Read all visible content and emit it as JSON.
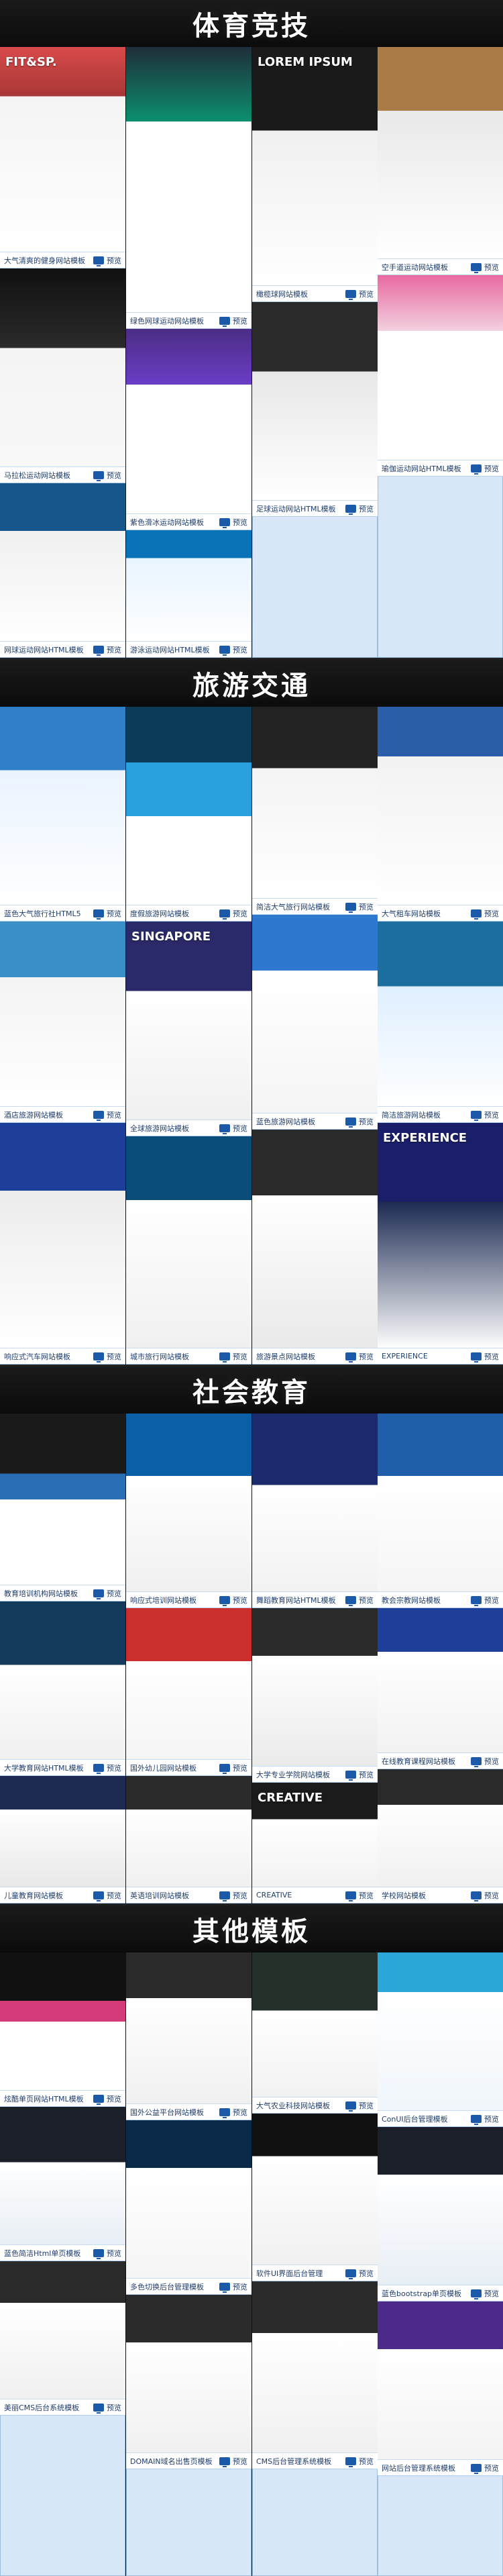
{
  "sections": [
    {
      "title": "体育竞技",
      "items": [
        {
          "caption": "大气清爽的健身网站模板",
          "preview": "预览",
          "thumb": {
            "title": "FIT&SP.",
            "colors": [
              "#d94a4a",
              "#f4f4f4",
              "#ffffff"
            ]
          }
        },
        {
          "caption": "绿色网球运动网站模板",
          "preview": "预览",
          "thumb": {
            "title": "",
            "colors": [
              "#0c8f6e",
              "#1f2e3a",
              "#ffffff"
            ]
          }
        },
        {
          "caption": "橄榄球网站模板",
          "preview": "预览",
          "thumb": {
            "title": "LOREM IPSUM",
            "colors": [
              "#1a1a1a",
              "#f0f0f0",
              "#ffffff"
            ]
          }
        },
        {
          "caption": "空手道运动网站模板",
          "preview": "预览",
          "thumb": {
            "title": "",
            "colors": [
              "#a97c47",
              "#e9e9e9",
              "#ffffff"
            ]
          }
        },
        {
          "caption": "马拉松运动网站模板",
          "preview": "预览",
          "thumb": {
            "title": "",
            "colors": [
              "#111",
              "#f4f4f4",
              "#f8f8f8"
            ]
          }
        },
        {
          "caption": "紫色滑冰运动网站模板",
          "preview": "预览",
          "thumb": {
            "title": "",
            "colors": [
              "#4b2d84",
              "#ffffff",
              "#6a3dc6"
            ]
          }
        },
        {
          "caption": "足球运动网站HTML模板",
          "preview": "预览",
          "thumb": {
            "title": "",
            "colors": [
              "#2a2a2a",
              "#e8e8e8",
              "#ffffff"
            ]
          }
        },
        {
          "caption": "瑜伽运动网站HTML模板",
          "preview": "预览",
          "thumb": {
            "title": "",
            "colors": [
              "#e96aa0",
              "#ffffff",
              "#f2d0df"
            ]
          }
        },
        {
          "caption": "网球运动网站HTML模板",
          "preview": "预览",
          "thumb": {
            "title": "",
            "colors": [
              "#17568b",
              "#f0f0f0",
              "#ffffff"
            ]
          }
        },
        {
          "caption": "游泳运动网站HTML模板",
          "preview": "预览",
          "thumb": {
            "title": "",
            "colors": [
              "#0a73b7",
              "#e8f4ff",
              "#ffffff"
            ]
          }
        }
      ]
    },
    {
      "title": "旅游交通",
      "items": [
        {
          "caption": "蓝色大气旅行社HTML5",
          "preview": "预览",
          "thumb": {
            "title": "",
            "colors": [
              "#2e7ec8",
              "#ffffff",
              "#eaf3ff"
            ]
          }
        },
        {
          "caption": "度假旅游网站模板",
          "preview": "预览",
          "thumb": {
            "title": "",
            "colors": [
              "#0c3b5a",
              "#2aa0de",
              "#ffffff"
            ]
          }
        },
        {
          "caption": "简洁大气旅行网站模板",
          "preview": "预览",
          "thumb": {
            "title": "",
            "colors": [
              "#222",
              "#f4f4f4",
              "#1b74c5"
            ]
          }
        },
        {
          "caption": "大气租车网站模板",
          "preview": "预览",
          "thumb": {
            "title": "",
            "colors": [
              "#2a5ea8",
              "#f2f2f2",
              "#ffffff"
            ]
          }
        },
        {
          "caption": "酒店旅游网站模板",
          "preview": "预览",
          "thumb": {
            "title": "",
            "colors": [
              "#3b8fc9",
              "#ffffff",
              "#f4f4f4"
            ]
          }
        },
        {
          "caption": "全球旅游网站模板",
          "preview": "预览",
          "thumb": {
            "title": "SINGAPORE",
            "colors": [
              "#2a2a6a",
              "#ffffff",
              "#f0f0f0"
            ]
          }
        },
        {
          "caption": "蓝色旅游网站模板",
          "preview": "预览",
          "thumb": {
            "title": "",
            "colors": [
              "#2f78d0",
              "#ffffff",
              "#f5f5f5"
            ]
          }
        },
        {
          "caption": "简洁旅游网站模板",
          "preview": "预览",
          "thumb": {
            "title": "",
            "colors": [
              "#1b6e9e",
              "#dfefff",
              "#ffffff"
            ]
          }
        },
        {
          "caption": "响应式汽车网站模板",
          "preview": "预览",
          "thumb": {
            "title": "",
            "colors": [
              "#1d3f9a",
              "#ffffff",
              "#ececec"
            ]
          }
        },
        {
          "caption": "城市旅行网站模板",
          "preview": "预览",
          "thumb": {
            "title": "",
            "colors": [
              "#0a4c7a",
              "#fff",
              "#f0f0f0"
            ]
          }
        },
        {
          "caption": "旅游景点网站模板",
          "preview": "预览",
          "thumb": {
            "title": "",
            "colors": [
              "#2a2a2a",
              "#ffffff",
              "#e9e9e9"
            ]
          }
        },
        {
          "caption": "EXPERIENCE",
          "preview": "预览",
          "thumb": {
            "title": "EXPERIENCE",
            "colors": [
              "#1b1f6a",
              "#ffffff",
              "#1c2a52"
            ]
          }
        }
      ]
    },
    {
      "title": "社会教育",
      "items": [
        {
          "caption": "教育培训机构网站模板",
          "preview": "预览",
          "thumb": {
            "title": "",
            "colors": [
              "#1a1a1a",
              "#2a6fb5",
              "#ffffff"
            ]
          }
        },
        {
          "caption": "响应式培训网站模板",
          "preview": "预览",
          "thumb": {
            "title": "",
            "colors": [
              "#0b5fa6",
              "#ffffff",
              "#f0f0f0"
            ]
          }
        },
        {
          "caption": "舞蹈教育网站HTML模板",
          "preview": "预览",
          "thumb": {
            "title": "",
            "colors": [
              "#1a2a6c",
              "#ffffff",
              "#f2f2f2"
            ]
          }
        },
        {
          "caption": "教会宗教网站模板",
          "preview": "预览",
          "thumb": {
            "title": "",
            "colors": [
              "#1f5ea8",
              "#ffffff",
              "#f5f5f5"
            ]
          }
        },
        {
          "caption": "大学教育网站HTML模板",
          "preview": "预览",
          "thumb": {
            "title": "",
            "colors": [
              "#143b5b",
              "#ffffff",
              "#f0f0f0"
            ]
          }
        },
        {
          "caption": "国外幼儿园网站模板",
          "preview": "预览",
          "thumb": {
            "title": "",
            "colors": [
              "#cc2d2d",
              "#ffffff",
              "#f5f5f5"
            ]
          }
        },
        {
          "caption": "大学专业学院网站模板",
          "preview": "预览",
          "thumb": {
            "title": "",
            "colors": [
              "#2b2b2b",
              "#ffffff",
              "#eaeaea"
            ]
          }
        },
        {
          "caption": "在线教育课程网站模板",
          "preview": "预览",
          "thumb": {
            "title": "",
            "colors": [
              "#1d3f9a",
              "#ffffff",
              "#f2f2f2"
            ]
          }
        },
        {
          "caption": "儿童教育网站模板",
          "preview": "预览",
          "thumb": {
            "title": "",
            "colors": [
              "#1e2a52",
              "#ffffff",
              "#e8e8e8"
            ]
          }
        },
        {
          "caption": "英语培训网站模板",
          "preview": "预览",
          "thumb": {
            "title": "",
            "colors": [
              "#2b2b2b",
              "#ffffff",
              "#f0f0f0"
            ]
          }
        },
        {
          "caption": "CREATIVE",
          "preview": "预览",
          "thumb": {
            "title": "CREATIVE",
            "colors": [
              "#1b1b1b",
              "#ffffff",
              "#f2f2f2"
            ]
          }
        },
        {
          "caption": "学校网站模板",
          "preview": "预览",
          "thumb": {
            "title": "",
            "colors": [
              "#2a2a2a",
              "#ffffff",
              "#f0f0f0"
            ]
          }
        }
      ]
    },
    {
      "title": "其他模板",
      "items": [
        {
          "caption": "炫酷单页网站HTML模板",
          "preview": "预览",
          "thumb": {
            "title": "",
            "colors": [
              "#111",
              "#ffffff",
              "#d23b77"
            ]
          }
        },
        {
          "caption": "国外公益平台网站模板",
          "preview": "预览",
          "thumb": {
            "title": "",
            "colors": [
              "#2a2a2a",
              "#ffffff",
              "#f0f0f0"
            ]
          }
        },
        {
          "caption": "大气农业科技网站模板",
          "preview": "预览",
          "thumb": {
            "title": "",
            "colors": [
              "#24302a",
              "#ffffff",
              "#f2f2f2"
            ]
          }
        },
        {
          "caption": "ConUI后台管理模板",
          "preview": "预览",
          "thumb": {
            "title": "",
            "colors": [
              "#2aa7d8",
              "#ffffff",
              "#f0f6fb"
            ]
          }
        },
        {
          "caption": "蓝色简洁Html单页模板",
          "preview": "预览",
          "thumb": {
            "title": "",
            "colors": [
              "#1b1f2a",
              "#ffffff",
              "#e8eef5"
            ]
          }
        },
        {
          "caption": "多色切换后台管理模板",
          "preview": "预览",
          "thumb": {
            "title": "",
            "colors": [
              "#0b2a4a",
              "#ffffff",
              "#f5f5f5"
            ]
          }
        },
        {
          "caption": "软件UI界面后台管理",
          "preview": "预览",
          "thumb": {
            "title": "",
            "colors": [
              "#111",
              "#ffffff",
              "#f0f0f0"
            ]
          }
        },
        {
          "caption": "蓝色bootstrap单页模板",
          "preview": "预览",
          "thumb": {
            "title": "",
            "colors": [
              "#1b1f2a",
              "#ffffff",
              "#e8eef5"
            ]
          }
        },
        {
          "caption": "美丽CMS后台系统模板",
          "preview": "预览",
          "thumb": {
            "title": "",
            "colors": [
              "#2a2a2a",
              "#ffffff",
              "#f0f0f0"
            ]
          }
        },
        {
          "caption": "DOMAIN域名出售页模板",
          "preview": "预览",
          "thumb": {
            "title": "",
            "colors": [
              "#2b2b2b",
              "#ffffff",
              "#f0f0f0"
            ]
          }
        },
        {
          "caption": "CMS后台管理系统模板",
          "preview": "预览",
          "thumb": {
            "title": "",
            "colors": [
              "#2b2b2b",
              "#ffffff",
              "#f0f0f0"
            ]
          }
        },
        {
          "caption": "网站后台管理系统模板",
          "preview": "预览",
          "thumb": {
            "title": "",
            "colors": [
              "#4c2a8a",
              "#ffffff",
              "#f3f3f3"
            ]
          }
        }
      ]
    }
  ]
}
